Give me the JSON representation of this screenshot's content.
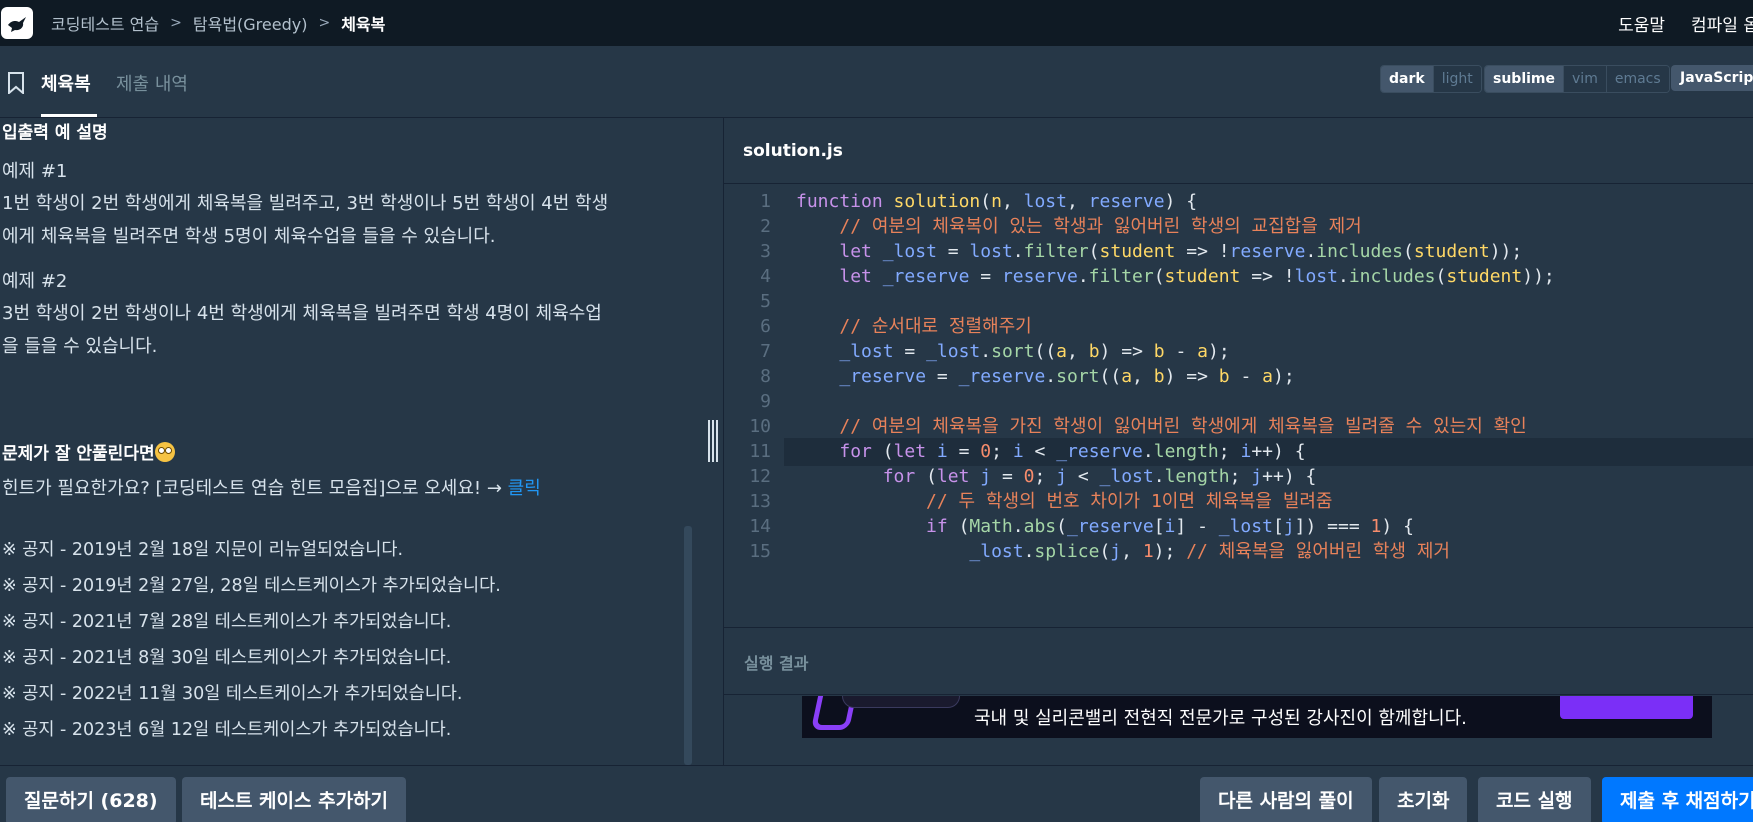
{
  "nav": {
    "breadcrumbs": [
      "코딩테스트 연습",
      "탐욕법(Greedy)",
      "체육복"
    ],
    "help_label": "도움말",
    "compile_label": "컴파일 옵"
  },
  "tabs": {
    "active_label": "체육복",
    "inactive_label": "제출 내역"
  },
  "editor_options": {
    "theme": [
      "dark",
      "light"
    ],
    "keymap": [
      "sublime",
      "vim",
      "emacs"
    ],
    "language": "JavaScript"
  },
  "description": {
    "io_heading": "입출력 예 설명",
    "example1_title": "예제 #1",
    "example1_line1": "1번 학생이 2번 학생에게 체육복을 빌려주고, 3번 학생이나 5번 학생이 4번 학생",
    "example1_line2": "에게 체육복을 빌려주면 학생 5명이 체육수업을 들을 수 있습니다.",
    "example2_title": "예제 #2",
    "example2_line1": "3번 학생이 2번 학생이나 4번 학생에게 체육복을 빌려주면 학생 4명이 체육수업",
    "example2_line2": "을 들을 수 있습니다.",
    "hint_heading": "문제가 잘 안풀린다면",
    "hint_text": "힌트가 필요한가요? [코딩테스트 연습 힌트 모음집]으로 오세요! → ",
    "hint_link": "클릭",
    "notices": [
      "※ 공지 - 2019년 2월 18일 지문이 리뉴얼되었습니다.",
      "※ 공지 - 2019년 2월 27일, 28일 테스트케이스가 추가되었습니다.",
      "※ 공지 - 2021년 7월 28일 테스트케이스가 추가되었습니다.",
      "※ 공지 - 2021년 8월 30일 테스트케이스가 추가되었습니다.",
      "※ 공지 - 2022년 11월 30일 테스트케이스가 추가되었습니다.",
      "※ 공지 - 2023년 6월 12일 테스트케이스가 추가되었습니다."
    ]
  },
  "editor": {
    "filename": "solution.js",
    "active_line": 11,
    "lines": [
      "function solution(n, lost, reserve) {",
      "    // 여분의 체육복이 있는 학생과 잃어버린 학생의 교집합을 제거",
      "    let _lost = lost.filter(student => !reserve.includes(student));",
      "    let _reserve = reserve.filter(student => !lost.includes(student));",
      "",
      "    // 순서대로 정렬해주기",
      "    _lost = _lost.sort((a, b) => b - a);",
      "    _reserve = _reserve.sort((a, b) => b - a);",
      "",
      "    // 여분의 체육복을 가진 학생이 잃어버린 학생에게 체육복을 빌려줄 수 있는지 확인",
      "    for (let i = 0; i < _reserve.length; i++) {",
      "        for (let j = 0; j < _lost.length; j++) {",
      "            // 두 학생의 번호 차이가 1이면 체육복을 빌려줌",
      "            if (Math.abs(_reserve[i] - _lost[j]) === 1) {",
      "                _lost.splice(j, 1); // 체육복을 잃어버린 학생 제거"
    ],
    "colors": {
      "keyword": "#c792ea",
      "function": "#ffd866",
      "param": "#ffd866",
      "comment": "#e8825a",
      "property": "#82aaff",
      "builtin": "#a5d6a7",
      "number": "#f78c6c",
      "plain": "#e2e8ee"
    }
  },
  "result": {
    "label": "실행 결과",
    "banner_text": "국내 및 실리콘밸리 전현직 전문가로 구성된 강사진이 함께합니다."
  },
  "actions": {
    "question": "질문하기 (628)",
    "add_testcase": "테스트 케이스 추가하기",
    "others_solution": "다른 사람의 풀이",
    "reset": "초기화",
    "run": "코드 실행",
    "submit": "제출 후 채점하기"
  }
}
